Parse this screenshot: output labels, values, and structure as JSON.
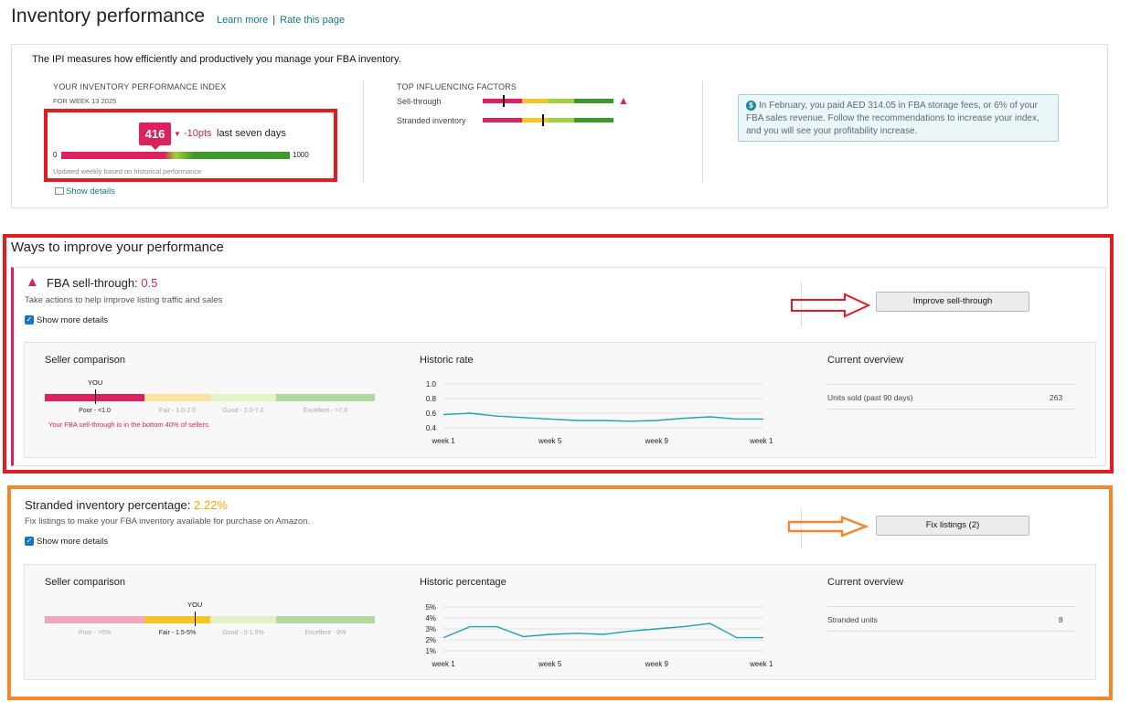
{
  "header": {
    "title": "Inventory performance",
    "learn_more": "Learn more",
    "separator": "|",
    "rate": "Rate this page"
  },
  "ipi": {
    "description": "The IPI measures how efficiently and productively you manage your FBA inventory.",
    "index_heading": "YOUR INVENTORY PERFORMANCE INDEX",
    "week": "FOR WEEK 13 2025",
    "score": "416",
    "change": "-10pts",
    "change_period": "last seven days",
    "min": "0",
    "max": "1000",
    "score_value": 416,
    "score_max": 1000,
    "updated": "Updated weekly based on historical performance",
    "show_details": "Show details",
    "factors_heading": "TOP INFLUENCING FACTORS",
    "factors": [
      {
        "label": "Sell-through",
        "warning": true
      },
      {
        "label": "Stranded inventory",
        "warning": false
      }
    ],
    "notice": "In February, you paid AED 314.05 in FBA storage fees, or 6% of your FBA sales revenue. Follow the recommendations to increase your index, and you will see your profitability increase.",
    "notice_icon": "dollar-icon"
  },
  "improve": {
    "title": "Ways to improve your performance",
    "sellthrough": {
      "title": "FBA sell-through:",
      "value": "0.5",
      "subtitle": "Take actions to help improve listing traffic and sales",
      "show_more": "Show more details",
      "button": "Improve sell-through",
      "seller_comparison": "Seller comparison",
      "you": "YOU",
      "bands": [
        "Poor - <1.0",
        "Fair - 1.0-2.0",
        "Good - 2.0-7.0",
        "Excellent - >7.0"
      ],
      "note": "Your FBA sell-through is in the bottom 40% of sellers.",
      "historic_title": "Historic rate",
      "overview_title": "Current overview",
      "overview_label": "Units sold (past 90 days)",
      "overview_value": "263"
    },
    "stranded": {
      "title": "Stranded inventory percentage:",
      "value": "2.22%",
      "subtitle": "Fix listings to make your FBA inventory available for purchase on Amazon.",
      "show_more": "Show more details",
      "button": "Fix listings (2)",
      "seller_comparison": "Seller comparison",
      "you": "YOU",
      "bands": [
        "Poor - >5%",
        "Fair - 1.5-5%",
        "Good - 0-1.5%",
        "Excellent - 0%"
      ],
      "historic_title": "Historic percentage",
      "overview_title": "Current overview",
      "overview_label": "Stranded units",
      "overview_value": "8"
    }
  },
  "colors": {
    "accent": "#0f7a8e",
    "poor": "#d9225e",
    "fair": "#f7c325",
    "good": "#9fd13c",
    "excellent": "#3d9a2a",
    "line": "#1ba4b5"
  },
  "chart_data": [
    {
      "type": "line",
      "title": "Historic rate",
      "x": [
        "week 1",
        "week 2",
        "week 3",
        "week 4",
        "week 5",
        "week 6",
        "week 7",
        "week 8",
        "week 9",
        "week 10",
        "week 11",
        "week 12",
        "week 13"
      ],
      "xticks": [
        "week 1",
        "week 5",
        "week 9",
        "week 13"
      ],
      "yticks": [
        "1.0",
        "0.8",
        "0.6",
        "0.4"
      ],
      "ylim": [
        0.4,
        1.0
      ],
      "values": [
        0.58,
        0.6,
        0.56,
        0.54,
        0.52,
        0.5,
        0.5,
        0.49,
        0.5,
        0.53,
        0.55,
        0.52,
        0.52
      ]
    },
    {
      "type": "line",
      "title": "Historic percentage",
      "x": [
        "week 1",
        "week 2",
        "week 3",
        "week 4",
        "week 5",
        "week 6",
        "week 7",
        "week 8",
        "week 9",
        "week 10",
        "week 11",
        "week 12",
        "week 13"
      ],
      "xticks": [
        "week 1",
        "week 5",
        "week 9",
        "week 13"
      ],
      "yticks": [
        "5%",
        "4%",
        "3%",
        "2%",
        "1%"
      ],
      "ylim": [
        1,
        5
      ],
      "values": [
        2.2,
        3.2,
        3.2,
        2.3,
        2.5,
        2.6,
        2.5,
        2.8,
        3.0,
        3.2,
        3.5,
        2.2,
        2.2
      ]
    }
  ]
}
